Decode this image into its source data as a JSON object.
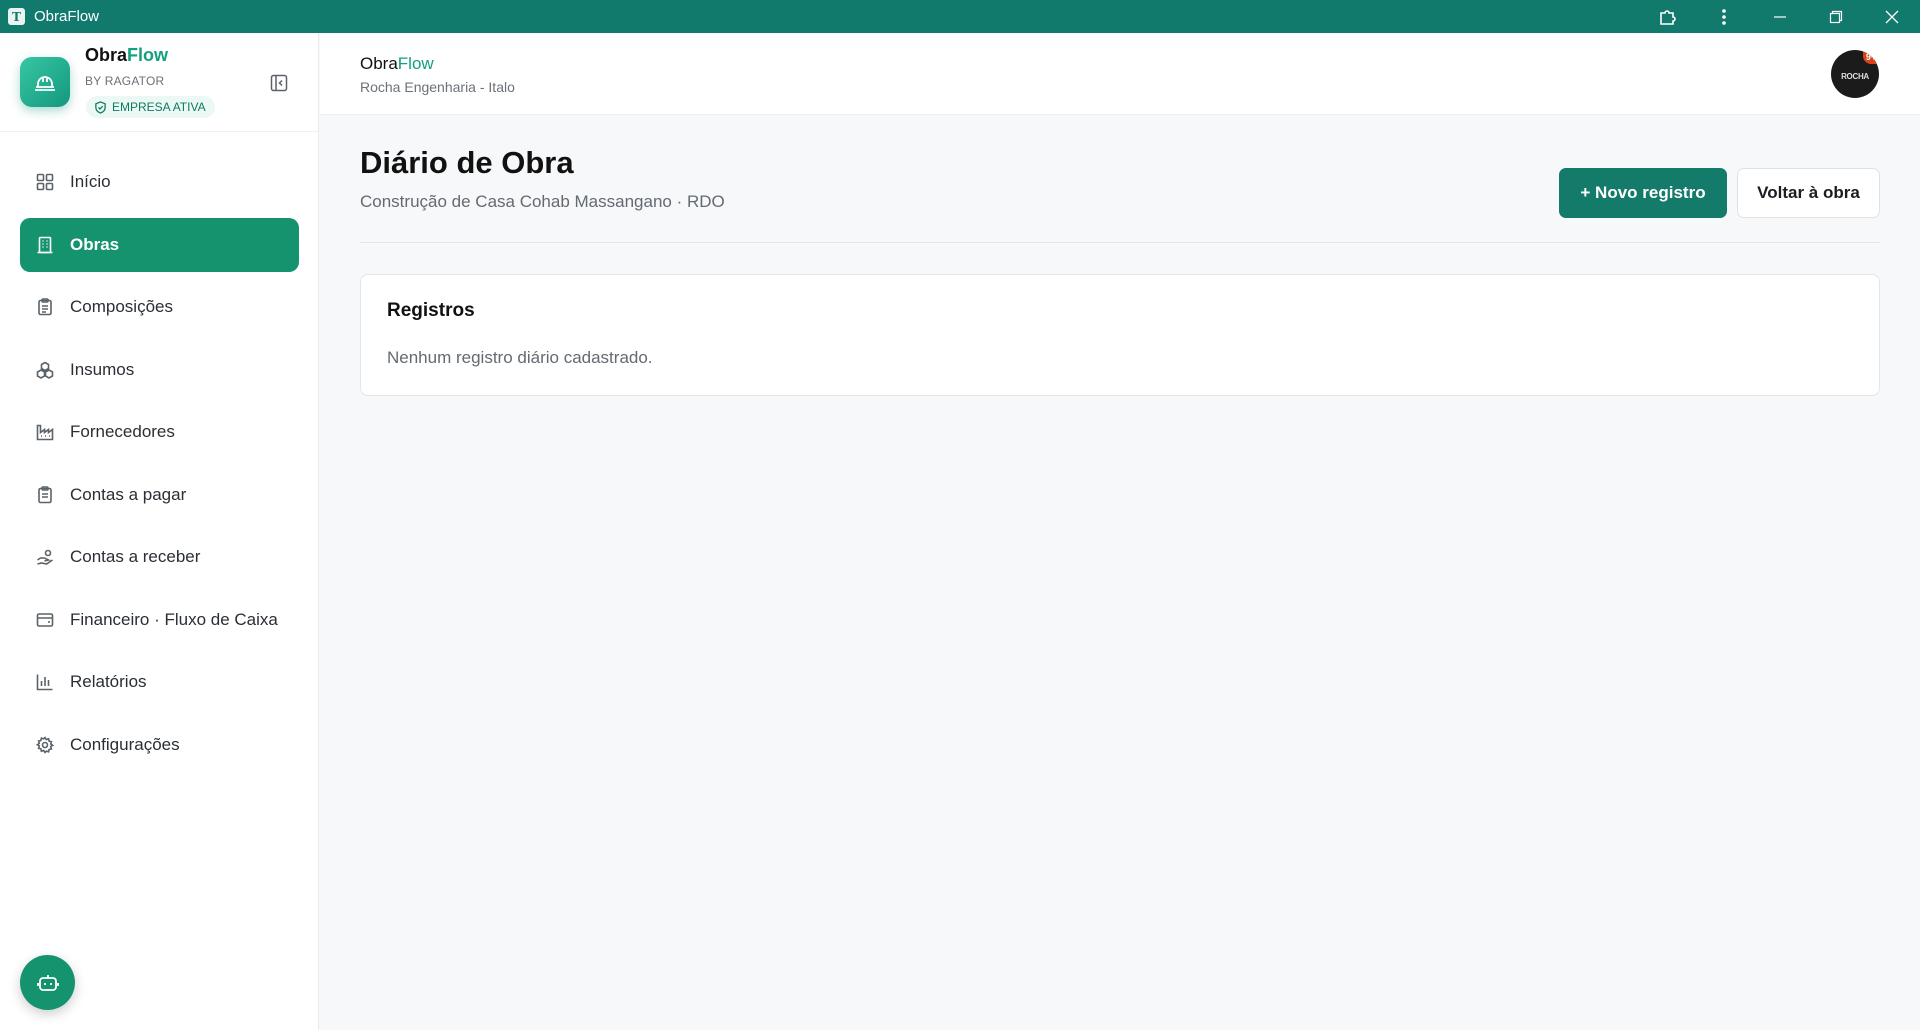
{
  "window": {
    "title": "ObraFlow",
    "app_icon": "app-logo-icon"
  },
  "sidebar": {
    "brand": {
      "name_prefix": "Obra",
      "name_accent": "Flow",
      "by": "BY RAGATOR",
      "status_badge": "EMPRESA ATIVA",
      "logo_icon": "hard-hat-icon"
    },
    "items": [
      {
        "label": "Início",
        "icon": "grid-icon",
        "active": false
      },
      {
        "label": "Obras",
        "icon": "building-icon",
        "active": true
      },
      {
        "label": "Composições",
        "icon": "clipboard-icon",
        "active": false
      },
      {
        "label": "Insumos",
        "icon": "boxes-icon",
        "active": false
      },
      {
        "label": "Fornecedores",
        "icon": "factory-icon",
        "active": false
      },
      {
        "label": "Contas a pagar",
        "icon": "receipt-icon",
        "active": false
      },
      {
        "label": "Contas a receber",
        "icon": "hand-coins-icon",
        "active": false
      },
      {
        "label": "Financeiro · Fluxo de Caixa",
        "icon": "wallet-icon",
        "active": false
      },
      {
        "label": "Relatórios",
        "icon": "bar-chart-icon",
        "active": false
      },
      {
        "label": "Configurações",
        "icon": "gear-icon",
        "active": false
      }
    ]
  },
  "header": {
    "brand_prefix": "Obra",
    "brand_accent": "Flow",
    "subtitle": "Rocha Engenharia - Italo",
    "avatar_text": "ROCHA",
    "avatar_badge": "9+"
  },
  "main": {
    "title": "Diário de Obra",
    "subtitle": "Construção de Casa Cohab Massangano · RDO",
    "new_button": "+ Novo registro",
    "back_button": "Voltar à obra",
    "card": {
      "title": "Registros",
      "empty": "Nenhum registro diário cadastrado."
    }
  },
  "colors": {
    "titlebar": "#127a6d",
    "accent": "#15936f",
    "brand_accent": "#13a07e",
    "primary_button": "#147a6a"
  }
}
